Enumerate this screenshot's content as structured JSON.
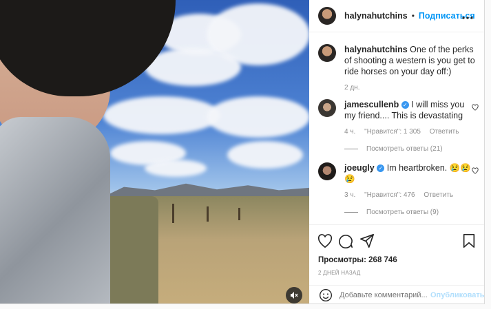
{
  "post": {
    "username": "halynahutchins",
    "follow_label": "Подписаться",
    "dot": "•",
    "caption": "One of the perks of shooting a western is you get to ride horses on your day off:)",
    "caption_time": "2 дн."
  },
  "comments": [
    {
      "username": "jamescullenb",
      "text": "I will miss you my friend.... This is devastating",
      "time": "4 ч.",
      "likes": "\"Нравится\": 1 305",
      "reply_label": "Ответить",
      "view_replies": "Посмотреть ответы (21)"
    },
    {
      "username": "joeugly",
      "text": "Im heartbroken. 😢😢😢",
      "time": "3 ч.",
      "likes": "\"Нравится\": 476",
      "reply_label": "Ответить",
      "view_replies": "Посмотреть ответы (9)"
    }
  ],
  "stats": {
    "views": "Просмотры: 268 746",
    "posted": "2 ДНЕЙ НАЗАД"
  },
  "add_comment": {
    "placeholder": "Добавьте комментарий...",
    "publish_label": "Опубликовать"
  },
  "icons": [
    "more-icon",
    "heart-icon",
    "comment-icon",
    "share-icon",
    "bookmark-icon",
    "smile-icon",
    "mute-icon",
    "verified-icon"
  ],
  "colors": {
    "accent": "#0095f6",
    "publish_disabled": "#b2dffc",
    "verified": "#3897f0",
    "muted_text": "#8e8e8e"
  }
}
